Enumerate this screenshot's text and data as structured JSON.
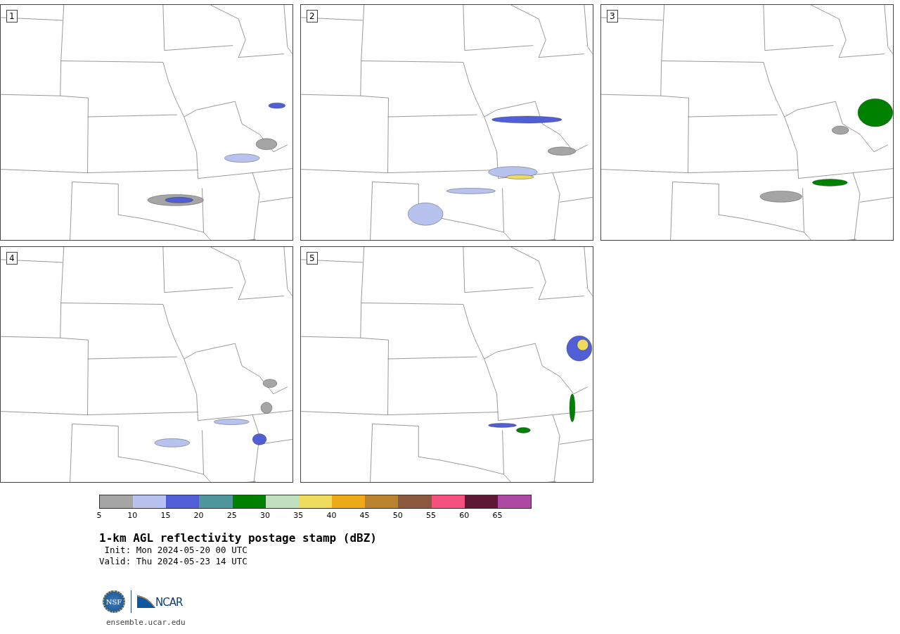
{
  "panels": [
    {
      "label": "1"
    },
    {
      "label": "2"
    },
    {
      "label": "3"
    },
    {
      "label": "4"
    },
    {
      "label": "5"
    }
  ],
  "colorbar": {
    "segments": [
      {
        "color": "#a5a5a5"
      },
      {
        "color": "#b7c3ee"
      },
      {
        "color": "#505fd6"
      },
      {
        "color": "#4f979c"
      },
      {
        "color": "#008000"
      },
      {
        "color": "#bfdfbe"
      },
      {
        "color": "#eedb5e"
      },
      {
        "color": "#eeaa18"
      },
      {
        "color": "#b9822f"
      },
      {
        "color": "#8b5a3e"
      },
      {
        "color": "#f5517f"
      },
      {
        "color": "#5f1736"
      },
      {
        "color": "#ab49a3"
      }
    ],
    "ticks": [
      "5",
      "10",
      "15",
      "20",
      "25",
      "30",
      "35",
      "40",
      "45",
      "50",
      "55",
      "60",
      "65"
    ]
  },
  "title": "1-km AGL reflectivity postage stamp (dBZ)",
  "init": " Init: Mon 2024-05-20 00 UTC",
  "valid": "Valid: Thu 2024-05-23 14 UTC",
  "logos": {
    "nsf": "NSF",
    "ncar": "NCAR"
  },
  "site": "ensemble.ucar.edu"
}
